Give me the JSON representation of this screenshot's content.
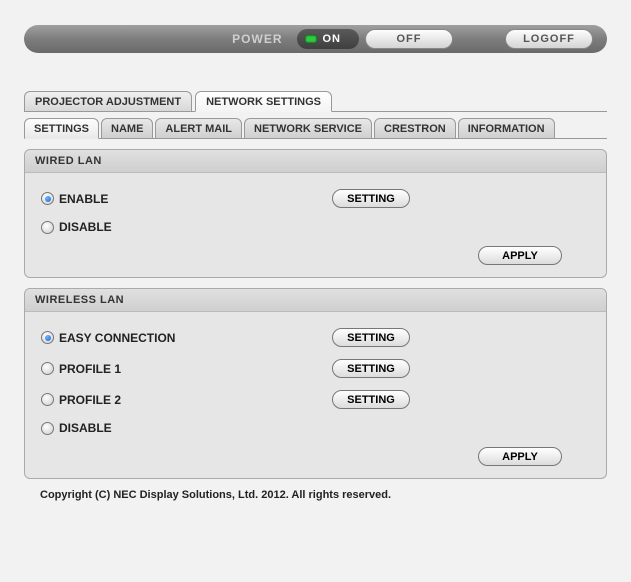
{
  "powerbar": {
    "label": "POWER",
    "on": "ON",
    "off": "OFF",
    "logoff": "LOGOFF"
  },
  "maintabs": {
    "projector": "PROJECTOR ADJUSTMENT",
    "network": "NETWORK SETTINGS"
  },
  "subtabs": {
    "settings": "SETTINGS",
    "name": "NAME",
    "alert": "ALERT MAIL",
    "service": "NETWORK SERVICE",
    "crestron": "CRESTRON",
    "info": "INFORMATION"
  },
  "wired": {
    "title": "WIRED LAN",
    "enable": "ENABLE",
    "disable": "DISABLE",
    "setting": "SETTING",
    "apply": "APPLY"
  },
  "wireless": {
    "title": "WIRELESS LAN",
    "easy": "EASY CONNECTION",
    "p1": "PROFILE 1",
    "p2": "PROFILE 2",
    "disable": "DISABLE",
    "setting": "SETTING",
    "apply": "APPLY"
  },
  "footer": "Copyright (C) NEC Display Solutions, Ltd. 2012. All rights reserved."
}
